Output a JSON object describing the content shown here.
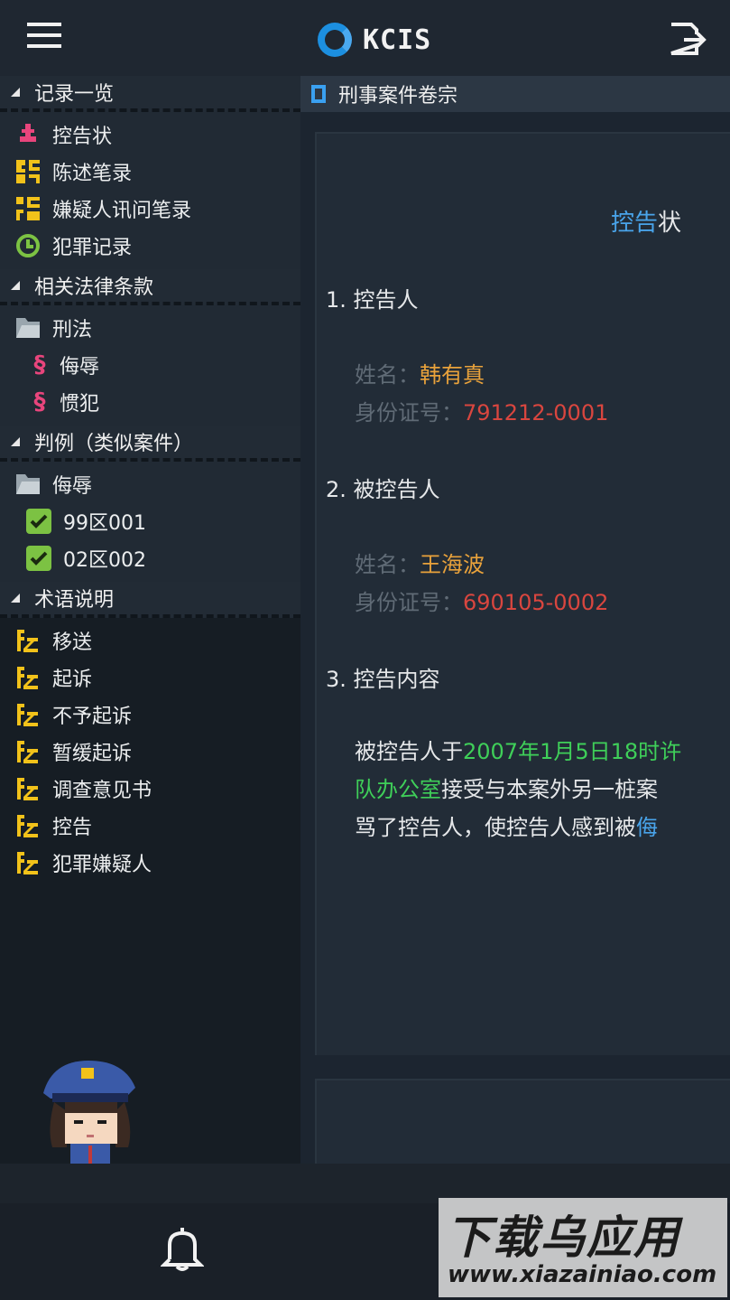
{
  "app": {
    "logo_text": "KCIS"
  },
  "sidebar": {
    "sections": [
      {
        "title": "记录一览",
        "items": [
          {
            "label": "控告状",
            "icon": "complaint-icon",
            "color": "#e8457c"
          },
          {
            "label": "陈述笔录",
            "icon": "statement-icon",
            "color": "#f2c21a"
          },
          {
            "label": "嫌疑人讯问笔录",
            "icon": "interrogation-icon",
            "color": "#f2c21a"
          },
          {
            "label": "犯罪记录",
            "icon": "record-clock-icon",
            "color": "#7cc243"
          }
        ]
      },
      {
        "title": "相关法律条款",
        "folder": "刑法",
        "items": [
          {
            "label": "侮辱",
            "icon": "section-sign-icon",
            "color": "#e8457c"
          },
          {
            "label": "惯犯",
            "icon": "section-sign-icon",
            "color": "#e8457c"
          }
        ]
      },
      {
        "title": "判例（类似案件）",
        "folder": "侮辱",
        "items": [
          {
            "label": "99区001",
            "icon": "checkbox-icon",
            "color": "#7cc243"
          },
          {
            "label": "02区002",
            "icon": "checkbox-icon",
            "color": "#7cc243"
          }
        ]
      },
      {
        "title": "术语说明",
        "items": [
          {
            "label": "移送",
            "icon": "term-icon"
          },
          {
            "label": "起诉",
            "icon": "term-icon"
          },
          {
            "label": "不予起诉",
            "icon": "term-icon"
          },
          {
            "label": "暂缓起诉",
            "icon": "term-icon"
          },
          {
            "label": "调查意见书",
            "icon": "term-icon"
          },
          {
            "label": "控告",
            "icon": "term-icon"
          },
          {
            "label": "犯罪嫌疑人",
            "icon": "term-icon"
          }
        ]
      }
    ]
  },
  "document": {
    "tab_title": "刑事案件卷宗",
    "title_highlight": "控告",
    "title_rest": "状",
    "section1": "1. 控告人",
    "plaintiff": {
      "name_label": "姓名：",
      "name": "韩有真",
      "id_label": "身份证号：",
      "id": "791212-0001"
    },
    "section2": "2. 被控告人",
    "defendant": {
      "name_label": "姓名：",
      "name": "王海波",
      "id_label": "身份证号：",
      "id": "690105-0002"
    },
    "section3": "3. 控告内容",
    "content": {
      "l1_a": "被控告人于",
      "l1_b": "2007年1月5日18时许",
      "l2_a": "队办公室",
      "l2_b": "接受与本案外另一桩案",
      "l3_a": "骂了控告人，使控告人感到被",
      "l3_b": "侮"
    }
  },
  "watermark": {
    "line1": "下载乌应用",
    "line2": "www.xiazainiao.com"
  },
  "colors": {
    "accent_blue": "#49a4ea",
    "name_orange": "#e9a23b",
    "id_red": "#d9463f",
    "highlight_green": "#3fcf59"
  }
}
